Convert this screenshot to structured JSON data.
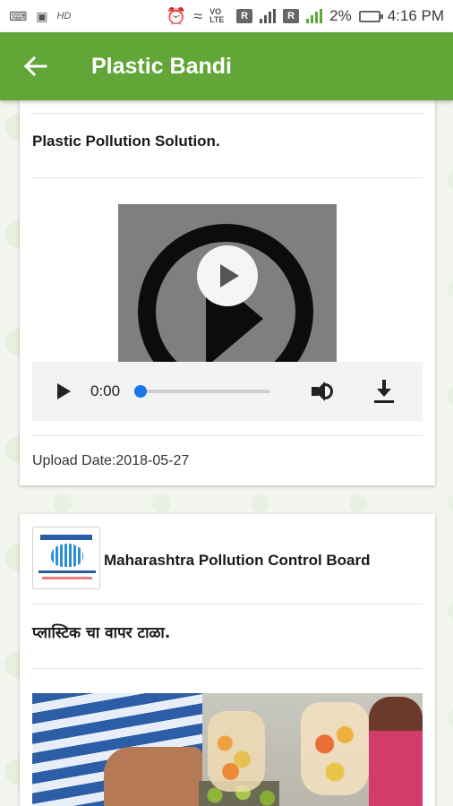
{
  "status_bar": {
    "battery_pct": "2%",
    "time": "4:16 PM",
    "volte": "VO LTE",
    "sim1": "R",
    "sim2": "R",
    "hd": "HD"
  },
  "app_bar": {
    "title": "Plastic Bandi"
  },
  "card1": {
    "post_title": "Plastic Pollution Solution.",
    "player": {
      "current_time": "0:00",
      "progress": 0
    },
    "upload_date": "Upload Date:2018-05-27"
  },
  "card2": {
    "org_name": "Maharashtra Pollution Control Board",
    "post_title": "प्लास्टिक चा वापर टाळा."
  },
  "colors": {
    "app_bar": "#62a637",
    "accent_blue": "#1a73e8"
  },
  "icons": {
    "back": "back-arrow-icon",
    "play": "play-icon",
    "volume": "volume-icon",
    "download": "download-icon"
  }
}
